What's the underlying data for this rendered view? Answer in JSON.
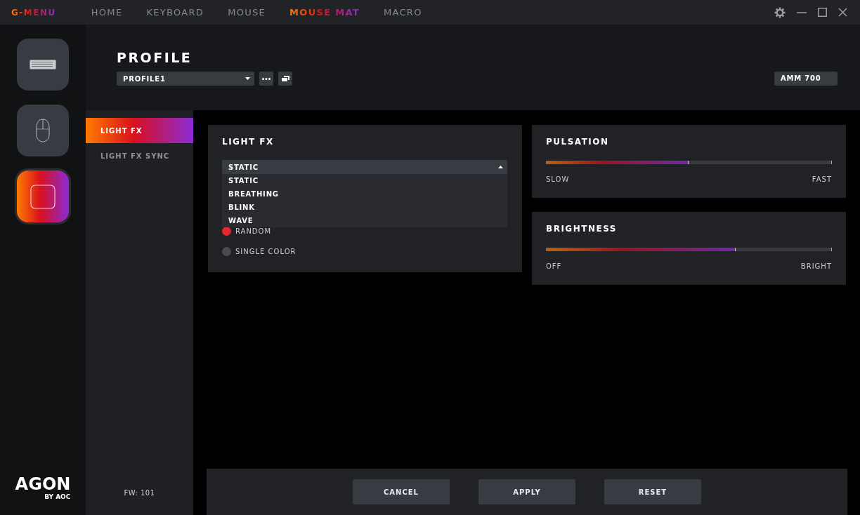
{
  "app": {
    "logo": "G-MENU"
  },
  "nav": [
    {
      "label": "HOME",
      "selected": false
    },
    {
      "label": "KEYBOARD",
      "selected": false
    },
    {
      "label": "MOUSE",
      "selected": false
    },
    {
      "label": "MOUSE MAT",
      "selected": true
    },
    {
      "label": "MACRO",
      "selected": false
    }
  ],
  "devices": [
    {
      "kind": "keyboard",
      "selected": false
    },
    {
      "kind": "mouse",
      "selected": false
    },
    {
      "kind": "mousemat",
      "selected": true
    }
  ],
  "brand": {
    "name": "AGON",
    "byline": "BY AOC"
  },
  "profile": {
    "title": "PROFILE",
    "selected_profile": "PROFILE1",
    "device_model": "AMM 700"
  },
  "subnav": {
    "items": [
      {
        "label": "LIGHT FX",
        "selected": true
      },
      {
        "label": "LIGHT FX SYNC",
        "selected": false
      }
    ],
    "firmware": "FW: 101"
  },
  "light_fx": {
    "title": "LIGHT FX",
    "mode": "STATIC",
    "dropdown_expanded": true,
    "options": [
      "STATIC",
      "BREATHING",
      "BLINK",
      "WAVE"
    ],
    "color_modes": [
      {
        "label": "RANDOM",
        "selected": true
      },
      {
        "label": "SINGLE COLOR",
        "selected": false
      }
    ]
  },
  "sliders": [
    {
      "title": "PULSATION",
      "level": 0.5,
      "min_label": "SLOW",
      "max_label": "FAST"
    },
    {
      "title": "BRIGHTNESS",
      "level": 0.666,
      "min_label": "OFF",
      "max_label": "BRIGHT"
    }
  ],
  "buttons": [
    "CANCEL",
    "APPLY",
    "RESET"
  ]
}
